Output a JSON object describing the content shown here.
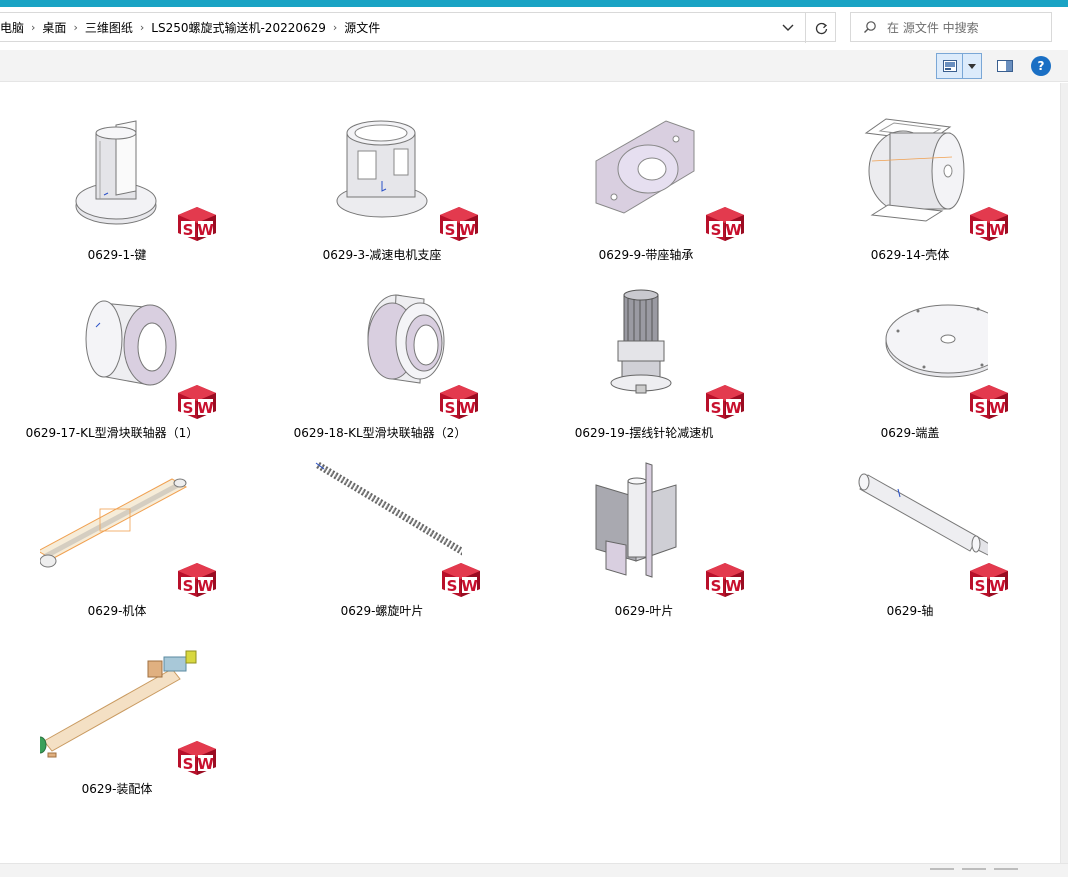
{
  "breadcrumb": {
    "items": [
      "电脑",
      "桌面",
      "三维图纸",
      "LS250螺旋式输送机-20220629",
      "源文件"
    ]
  },
  "search": {
    "placeholder": "在 源文件 中搜索"
  },
  "toolbar": {
    "help_label": "?"
  },
  "icons": {
    "solidworks_badge": "solidworks-file-icon",
    "refresh": "refresh-icon",
    "search": "search-icon",
    "dropdown": "chevron-down-icon"
  },
  "colors": {
    "accent": "#1aa3c4",
    "sw_red": "#c8102e"
  },
  "files": [
    {
      "name": "0629-1-键",
      "thumb": "key"
    },
    {
      "name": "0629-3-减速电机支座",
      "thumb": "motor-mount"
    },
    {
      "name": "0629-9-带座轴承",
      "thumb": "bearing"
    },
    {
      "name": "0629-14-壳体",
      "thumb": "housing"
    },
    {
      "name": "0629-17-KL型滑块联轴器（1）",
      "thumb": "coupling1"
    },
    {
      "name": "0629-18-KL型滑块联轴器（2）",
      "thumb": "coupling2"
    },
    {
      "name": "0629-19-摆线针轮减速机",
      "thumb": "reducer"
    },
    {
      "name": "0629-端盖",
      "thumb": "end-cover"
    },
    {
      "name": "0629-机体",
      "thumb": "body"
    },
    {
      "name": "0629-螺旋叶片",
      "thumb": "screw-blade"
    },
    {
      "name": "0629-叶片",
      "thumb": "blade"
    },
    {
      "name": "0629-轴",
      "thumb": "shaft"
    },
    {
      "name": "0629-装配体",
      "thumb": "assembly"
    }
  ]
}
